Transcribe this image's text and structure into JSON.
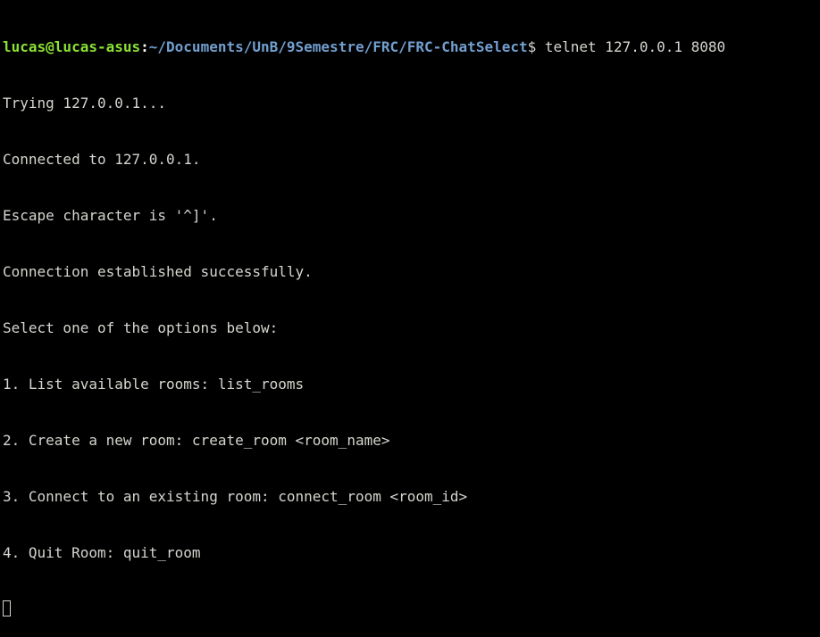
{
  "prompt": {
    "user_host": "lucas@lucas-asus",
    "separator": ":",
    "path": "~/Documents/UnB/9Semestre/FRC/FRC-ChatSelect",
    "symbol": "$ ",
    "command": "telnet 127.0.0.1 8080"
  },
  "output": [
    "Trying 127.0.0.1...",
    "Connected to 127.0.0.1.",
    "Escape character is '^]'.",
    "Connection established successfully.",
    "Select one of the options below:",
    "1. List available rooms: list_rooms",
    "2. Create a new room: create_room <room_name>",
    "3. Connect to an existing room: connect_room <room_id>",
    "4. Quit Room: quit_room"
  ],
  "colors": {
    "background": "#000000",
    "text": "#d3d7cf",
    "user_host": "#8ae234",
    "path": "#729fcf"
  }
}
